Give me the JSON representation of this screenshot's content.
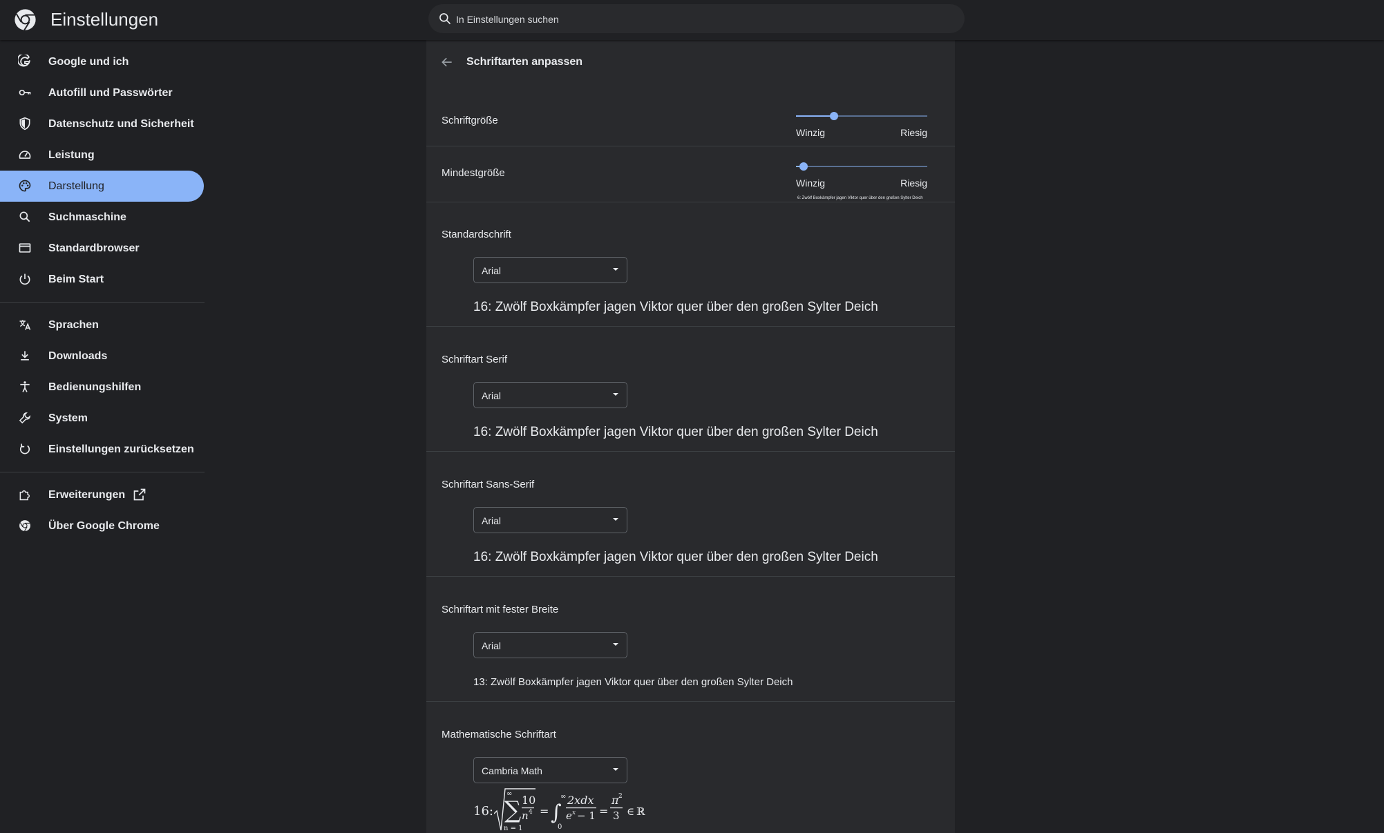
{
  "header": {
    "app_title": "Einstellungen",
    "search_placeholder": "In Einstellungen suchen"
  },
  "sidebar": {
    "items": [
      {
        "label": "Google und ich",
        "icon": "google-g-icon"
      },
      {
        "label": "Autofill und Passwörter",
        "icon": "key-icon"
      },
      {
        "label": "Datenschutz und Sicherheit",
        "icon": "shield-icon"
      },
      {
        "label": "Leistung",
        "icon": "speedometer-icon"
      },
      {
        "label": "Darstellung",
        "icon": "palette-icon",
        "active": true
      },
      {
        "label": "Suchmaschine",
        "icon": "search-icon"
      },
      {
        "label": "Standardbrowser",
        "icon": "browser-window-icon"
      },
      {
        "label": "Beim Start",
        "icon": "power-icon"
      }
    ],
    "items2": [
      {
        "label": "Sprachen",
        "icon": "translate-icon"
      },
      {
        "label": "Downloads",
        "icon": "download-icon"
      },
      {
        "label": "Bedienungshilfen",
        "icon": "accessibility-icon"
      },
      {
        "label": "System",
        "icon": "wrench-icon"
      },
      {
        "label": "Einstellungen zurücksetzen",
        "icon": "reset-icon"
      }
    ],
    "items3": [
      {
        "label": "Erweiterungen",
        "icon": "extension-puzzle-icon"
      },
      {
        "label": "Über Google Chrome",
        "icon": "chrome-logo-icon"
      }
    ]
  },
  "panel": {
    "title": "Schriftarten anpassen",
    "font_size": {
      "label": "Schriftgröße",
      "min_label": "Winzig",
      "max_label": "Riesig",
      "level": 0.29
    },
    "min_size": {
      "label": "Mindestgröße",
      "min_label": "Winzig",
      "max_label": "Riesig",
      "level": 0.06,
      "preview": "6: Zwölf Boxkämpfer jagen Viktor quer über den großen Sylter Deich"
    },
    "sections": [
      {
        "label": "Standardschrift",
        "selected": "Arial",
        "preview": "16: Zwölf Boxkämpfer jagen Viktor quer über den großen Sylter Deich"
      },
      {
        "label": "Schriftart Serif",
        "selected": "Arial",
        "preview": "16: Zwölf Boxkämpfer jagen Viktor quer über den großen Sylter Deich"
      },
      {
        "label": "Schriftart Sans-Serif",
        "selected": "Arial",
        "preview": "16: Zwölf Boxkämpfer jagen Viktor quer über den großen Sylter Deich"
      },
      {
        "label": "Schriftart mit fester Breite",
        "selected": "Arial",
        "preview": "13: Zwölf Boxkämpfer jagen Viktor quer über den großen Sylter Deich"
      },
      {
        "label": "Mathematische Schriftart",
        "selected": "Cambria Math",
        "preview_prefix": "16:"
      }
    ]
  },
  "colors": {
    "background": "#202124",
    "panel": "#292a2d",
    "accent": "#8ab4f8"
  }
}
